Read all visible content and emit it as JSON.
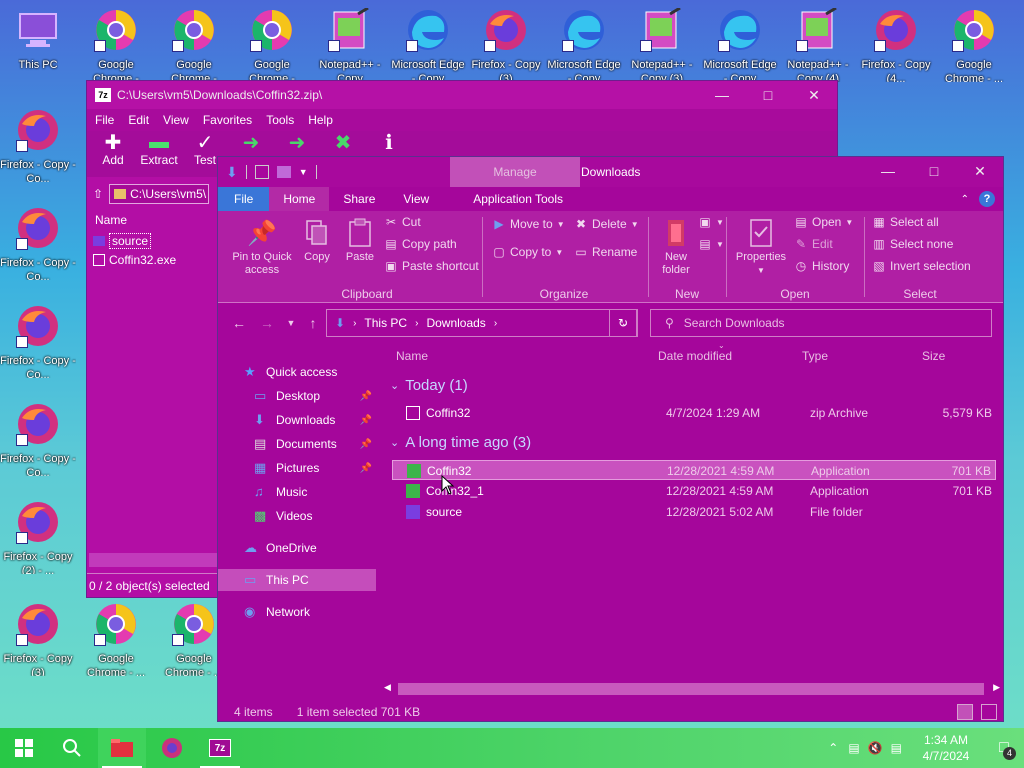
{
  "desktop": {
    "icons": [
      {
        "label": "This PC",
        "kind": "pc"
      },
      {
        "label": "Google Chrome -",
        "kind": "chrome"
      },
      {
        "label": "Google Chrome -",
        "kind": "chrome"
      },
      {
        "label": "Google Chrome -",
        "kind": "chrome"
      },
      {
        "label": "Notepad++ - Copy",
        "kind": "notepad"
      },
      {
        "label": "Microsoft Edge - Copy",
        "kind": "edge"
      },
      {
        "label": "Firefox - Copy (3)",
        "kind": "firefox"
      },
      {
        "label": "Microsoft Edge - Copy",
        "kind": "edge"
      },
      {
        "label": "Notepad++ - Copy (3)",
        "kind": "notepad"
      },
      {
        "label": "Microsoft Edge - Copy",
        "kind": "edge"
      },
      {
        "label": "Notepad++ - Copy (4)",
        "kind": "notepad"
      },
      {
        "label": "Firefox - Copy (4...",
        "kind": "firefox"
      },
      {
        "label": "Google Chrome - ...",
        "kind": "chrome"
      },
      {
        "label": "Firefox - Copy - Co...",
        "kind": "firefox"
      },
      {
        "label": "Firefox - Copy - Co...",
        "kind": "firefox"
      },
      {
        "label": "Firefox - Copy - Co...",
        "kind": "firefox"
      },
      {
        "label": "Firefox - Copy - Co...",
        "kind": "firefox"
      },
      {
        "label": "Firefox - Copy (2) - ...",
        "kind": "firefox"
      },
      {
        "label": "Firefox - Copy (3)",
        "kind": "firefox"
      },
      {
        "label": "Google Chrome - ...",
        "kind": "chrome"
      },
      {
        "label": "Google Chrome - ...",
        "kind": "chrome"
      }
    ]
  },
  "zip_window": {
    "title": "C:\\Users\\vm5\\Downloads\\Coffin32.zip\\",
    "app_icon": "7z",
    "menu": [
      "File",
      "Edit",
      "View",
      "Favorites",
      "Tools",
      "Help"
    ],
    "toolbar": [
      {
        "label": "Add",
        "icon": "plus-icon"
      },
      {
        "label": "Extract",
        "icon": "minus-icon"
      },
      {
        "label": "Test",
        "icon": "check-icon"
      },
      {
        "label": "",
        "icon": "copy-arrow-icon"
      },
      {
        "label": "",
        "icon": "move-arrow-icon"
      },
      {
        "label": "",
        "icon": "delete-x-icon"
      },
      {
        "label": "",
        "icon": "info-icon"
      }
    ],
    "address": "C:\\Users\\vm5\\",
    "column_name": "Name",
    "files": [
      {
        "name": "source",
        "type": "folder",
        "selected": true
      },
      {
        "name": "Coffin32.exe",
        "type": "exe",
        "selected": false
      }
    ],
    "status": "0 / 2 object(s) selected"
  },
  "explorer": {
    "manage_label": "Manage",
    "title": "Downloads",
    "tabs": [
      "File",
      "Home",
      "Share",
      "View",
      "Application Tools"
    ],
    "ribbon": {
      "clipboard": {
        "name": "Clipboard",
        "pin": "Pin to Quick access",
        "copy": "Copy",
        "paste": "Paste",
        "cut": "Cut",
        "copy_path": "Copy path",
        "paste_shortcut": "Paste shortcut"
      },
      "organize": {
        "name": "Organize",
        "move_to": "Move to",
        "copy_to": "Copy to",
        "delete": "Delete",
        "rename": "Rename"
      },
      "new": {
        "name": "New",
        "new_folder": "New folder"
      },
      "open": {
        "name": "Open",
        "properties": "Properties",
        "open": "Open",
        "edit": "Edit",
        "history": "History"
      },
      "select": {
        "name": "Select",
        "select_all": "Select all",
        "select_none": "Select none",
        "invert": "Invert selection"
      }
    },
    "path": [
      "This PC",
      "Downloads"
    ],
    "search_placeholder": "Search Downloads",
    "nav": [
      {
        "label": "Quick access",
        "icon": "star-icon",
        "indent": 1,
        "pinned": false
      },
      {
        "label": "Desktop",
        "icon": "desktop-icon",
        "indent": 2,
        "pinned": true
      },
      {
        "label": "Downloads",
        "icon": "download-icon",
        "indent": 2,
        "pinned": true
      },
      {
        "label": "Documents",
        "icon": "document-icon",
        "indent": 2,
        "pinned": true
      },
      {
        "label": "Pictures",
        "icon": "pictures-icon",
        "indent": 2,
        "pinned": true
      },
      {
        "label": "Music",
        "icon": "music-icon",
        "indent": 2,
        "pinned": false
      },
      {
        "label": "Videos",
        "icon": "video-icon",
        "indent": 2,
        "pinned": false
      },
      {
        "label": "OneDrive",
        "icon": "cloud-icon",
        "indent": 1,
        "pinned": false
      },
      {
        "label": "This PC",
        "icon": "pc-icon",
        "indent": 1,
        "pinned": false,
        "selected": true
      },
      {
        "label": "Network",
        "icon": "network-icon",
        "indent": 1,
        "pinned": false
      }
    ],
    "columns": {
      "name": "Name",
      "date": "Date modified",
      "type": "Type",
      "size": "Size"
    },
    "groups": [
      {
        "label": "Today (1)",
        "files": [
          {
            "name": "Coffin32",
            "date": "4/7/2024 1:29 AM",
            "type": "zip Archive",
            "size": "5,579 KB",
            "icon": "zip"
          }
        ]
      },
      {
        "label": "A long time ago (3)",
        "files": [
          {
            "name": "Coffin32",
            "date": "12/28/2021 4:59 AM",
            "type": "Application",
            "size": "701 KB",
            "icon": "app",
            "selected": true
          },
          {
            "name": "Coffin32_1",
            "date": "12/28/2021 4:59 AM",
            "type": "Application",
            "size": "701 KB",
            "icon": "app"
          },
          {
            "name": "source",
            "date": "12/28/2021 5:02 AM",
            "type": "File folder",
            "size": "",
            "icon": "folder"
          }
        ]
      }
    ],
    "status_items": "4 items",
    "status_selected": "1 item selected  701 KB"
  },
  "taskbar": {
    "time": "1:34 AM",
    "date": "4/7/2024",
    "notification_count": "4"
  },
  "colors": {
    "window_bg": "#a5069b",
    "file_tab": "#3a76d8",
    "taskbar": "#28c846"
  }
}
